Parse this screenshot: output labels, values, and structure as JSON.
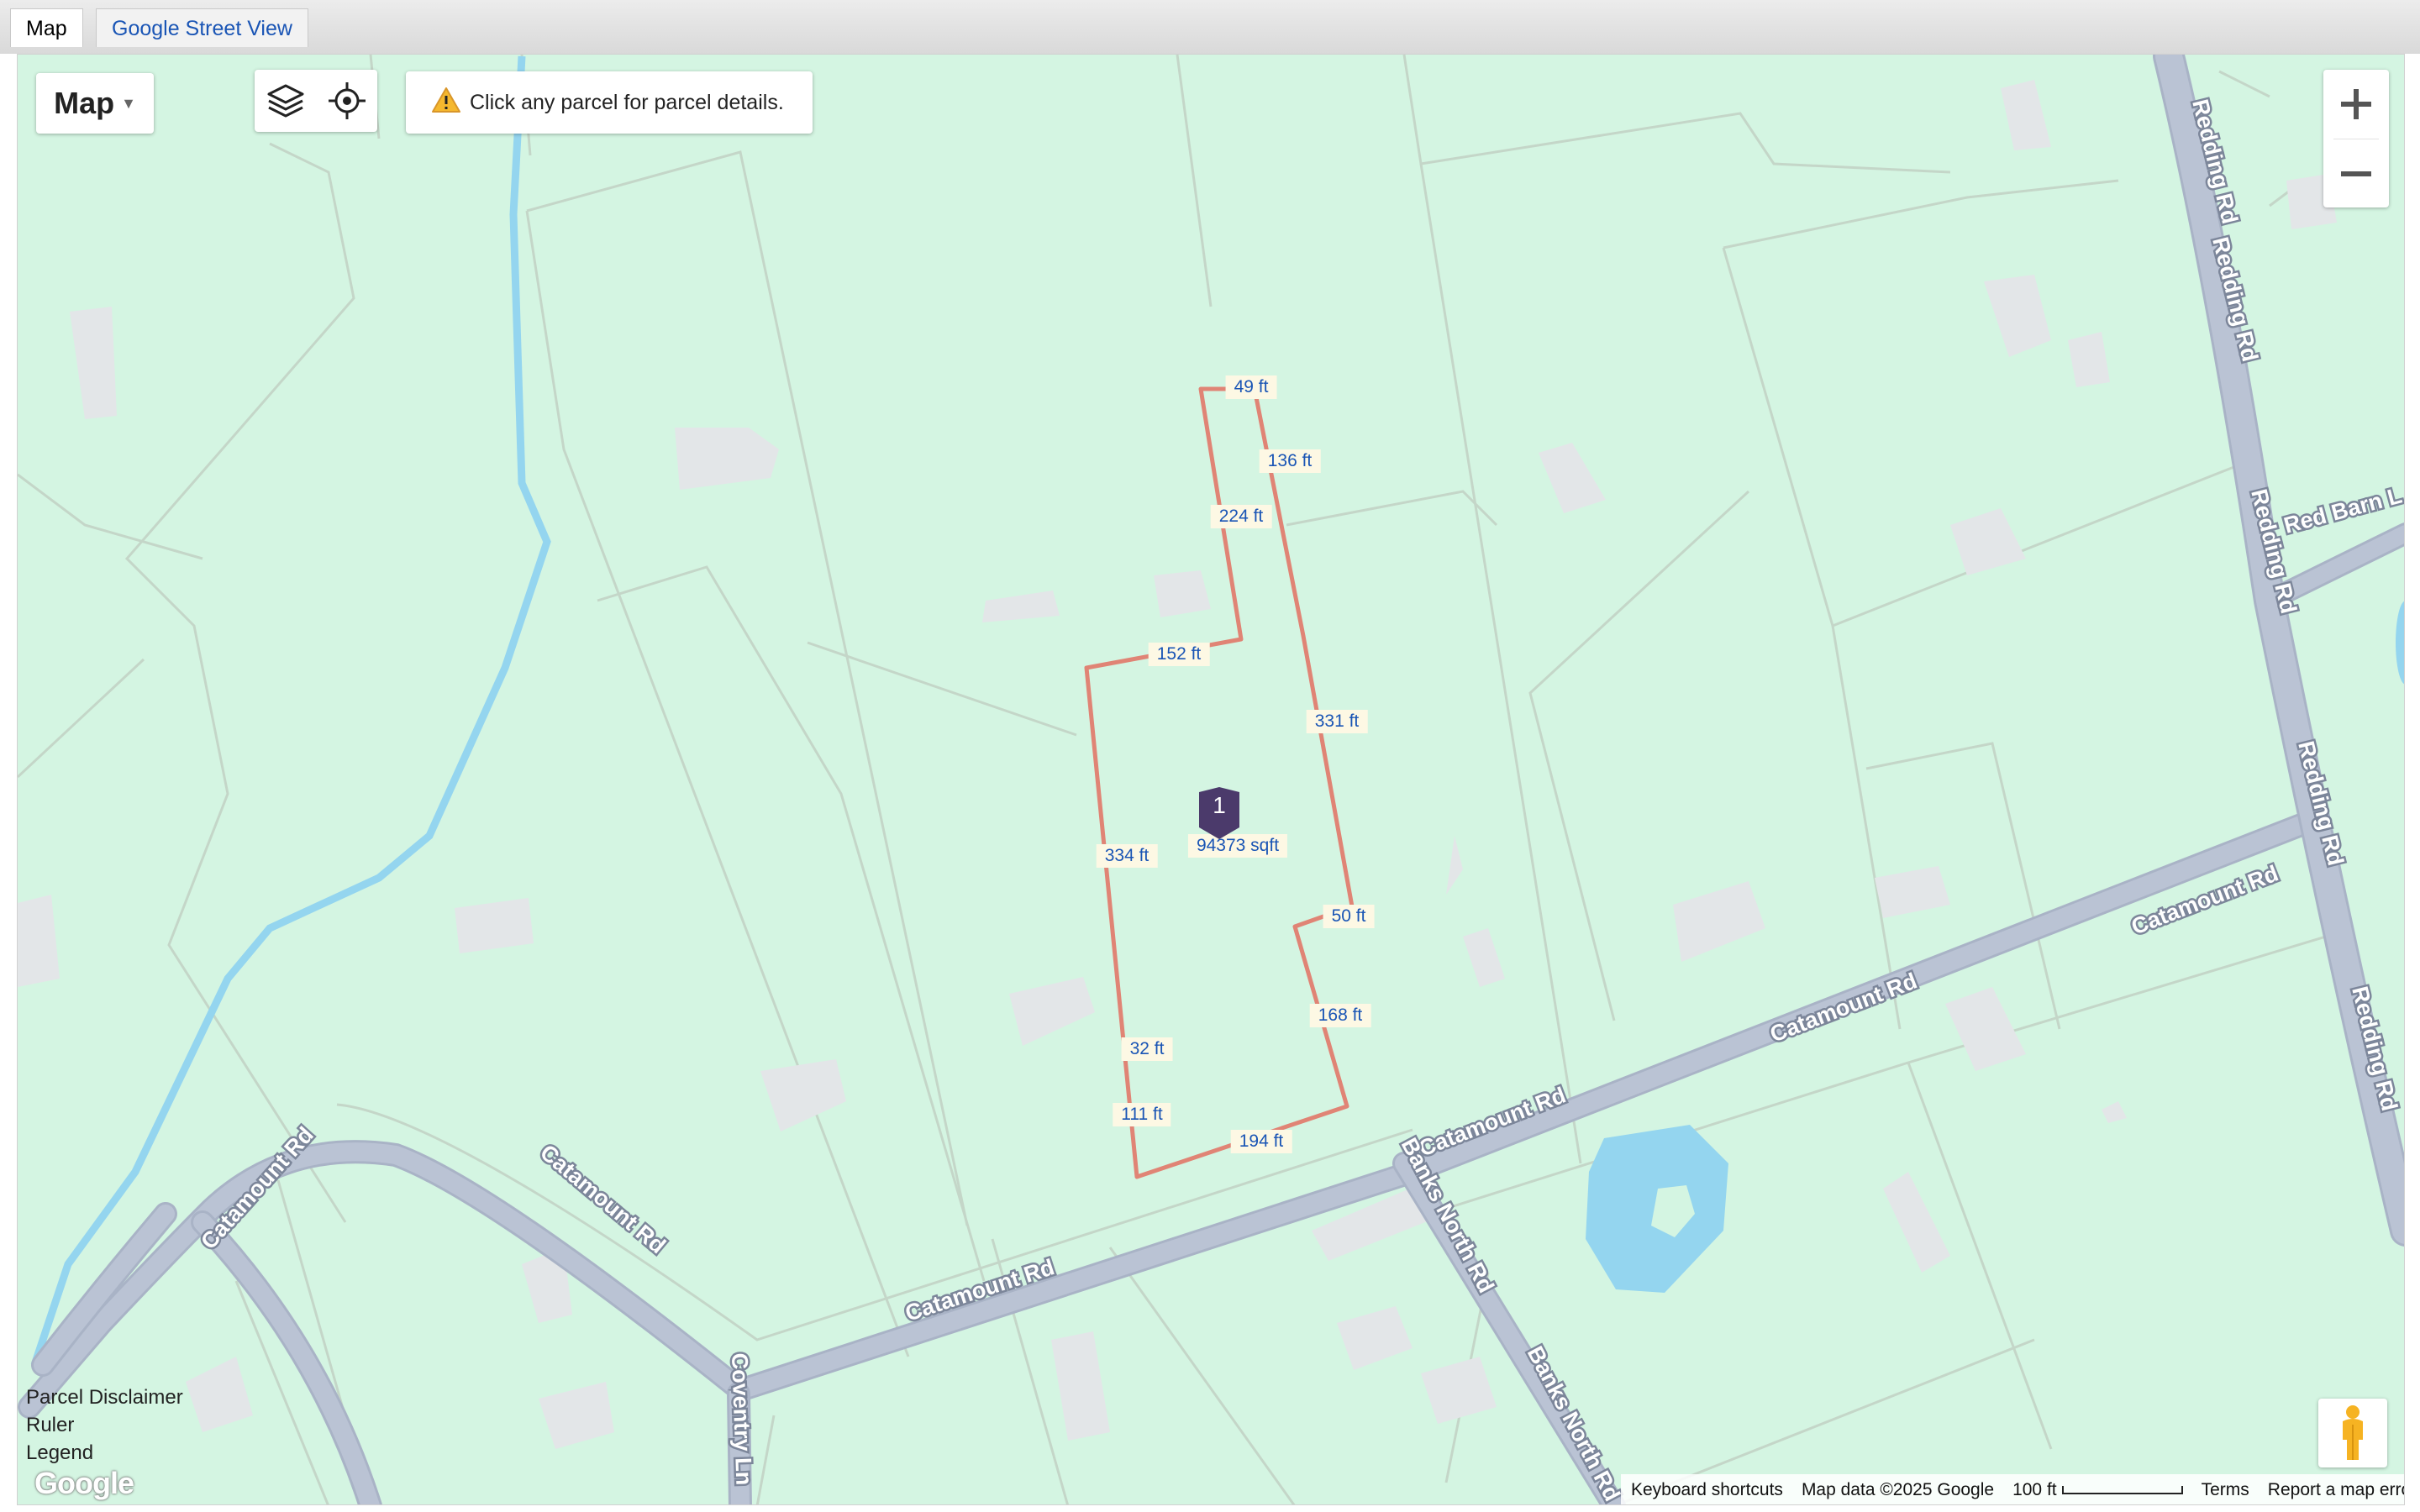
{
  "tabs": [
    {
      "label": "Map"
    },
    {
      "label": "Google Street View"
    }
  ],
  "map_controls": {
    "map_type": "Map",
    "notice": "Click any parcel for parcel details."
  },
  "parcel": {
    "marker_number": "1",
    "area": "94373 sqft",
    "segments": [
      "49 ft",
      "136 ft",
      "224 ft",
      "152 ft",
      "331 ft",
      "334 ft",
      "50 ft",
      "168 ft",
      "32 ft",
      "111 ft",
      "194 ft"
    ]
  },
  "roads": {
    "catamount": "Catamount Rd",
    "redding": "Redding Rd",
    "banks_north": "Banks North Rd",
    "coventry": "Coventry Ln",
    "red_barn": "Red Barn L"
  },
  "left_links": [
    "Parcel Disclaimer",
    "Ruler",
    "Legend"
  ],
  "google_logo": "Google",
  "footer": {
    "shortcuts": "Keyboard shortcuts",
    "map_data": "Map data ©2025 Google",
    "scale": "100 ft",
    "terms": "Terms",
    "report": "Report a map error"
  },
  "colors": {
    "land": "#d4f5e2",
    "road": "#b9c2d3",
    "water": "#94d5ef",
    "parcel_line": "#e08475",
    "marker": "#4b3a6b"
  }
}
